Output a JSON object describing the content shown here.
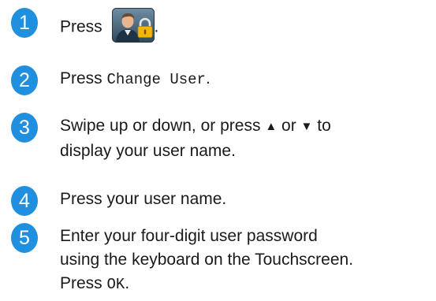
{
  "colors": {
    "step_circle": "#1f8fde",
    "text": "#1a1a1a",
    "lock": "#f2b705"
  },
  "steps": [
    {
      "number": "1",
      "word": "Press",
      "icon": "user-lock-icon",
      "after": "."
    },
    {
      "number": "2",
      "word": "Press",
      "mono": "Change User",
      "after": "."
    },
    {
      "number": "3",
      "line1_a": "Swipe up or down, or press",
      "up_glyph": "▲",
      "line1_b": "or",
      "down_glyph": "▼",
      "line1_c": "to",
      "line2": "display your user name."
    },
    {
      "number": "4",
      "text": "Press your user name."
    },
    {
      "number": "5",
      "line1": "Enter your four-digit user password",
      "line2": "using the keyboard on the Touchscreen.",
      "line3_word": "Press",
      "line3_mono": "OK",
      "after": "."
    }
  ]
}
